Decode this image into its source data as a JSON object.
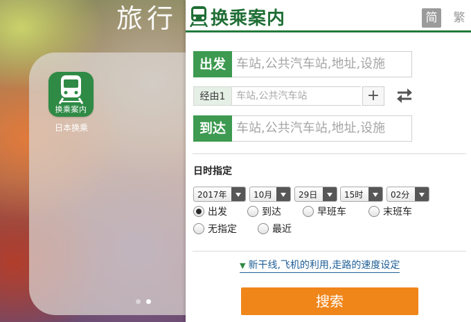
{
  "folder": {
    "title": "旅行",
    "app_icon_label": "换乘案内",
    "app_name": "日本换乘",
    "page_dots": 2,
    "active_dot": 2
  },
  "app": {
    "title": "换乘案内",
    "lang_simplified": "简",
    "lang_traditional": "繁",
    "departure": {
      "tag": "出发",
      "placeholder": "车站,公共汽车站,地址,设施"
    },
    "via": {
      "tag": "经由1",
      "placeholder": "车站,公共汽车站",
      "add": "+"
    },
    "arrival": {
      "tag": "到达",
      "placeholder": "车站,公共汽车站,地址,设施"
    },
    "datetime_heading": "日时指定",
    "selects": {
      "year": "2017年",
      "month": "10月",
      "day": "29日",
      "hour": "15时",
      "minute": "02分"
    },
    "radios": {
      "depart": "出发",
      "arrive": "到达",
      "first_train": "早班车",
      "last_train": "末班车",
      "unspecified": "无指定",
      "latest": "最近",
      "selected": "出发"
    },
    "advanced_link": "新干线,飞机的利用,走路的速度设定",
    "search_button": "搜索",
    "colors": {
      "brand_green": "#1f7a3a",
      "tag_green": "#3d9a50",
      "search_orange": "#f0861a",
      "link_blue": "#1e5e96"
    }
  }
}
